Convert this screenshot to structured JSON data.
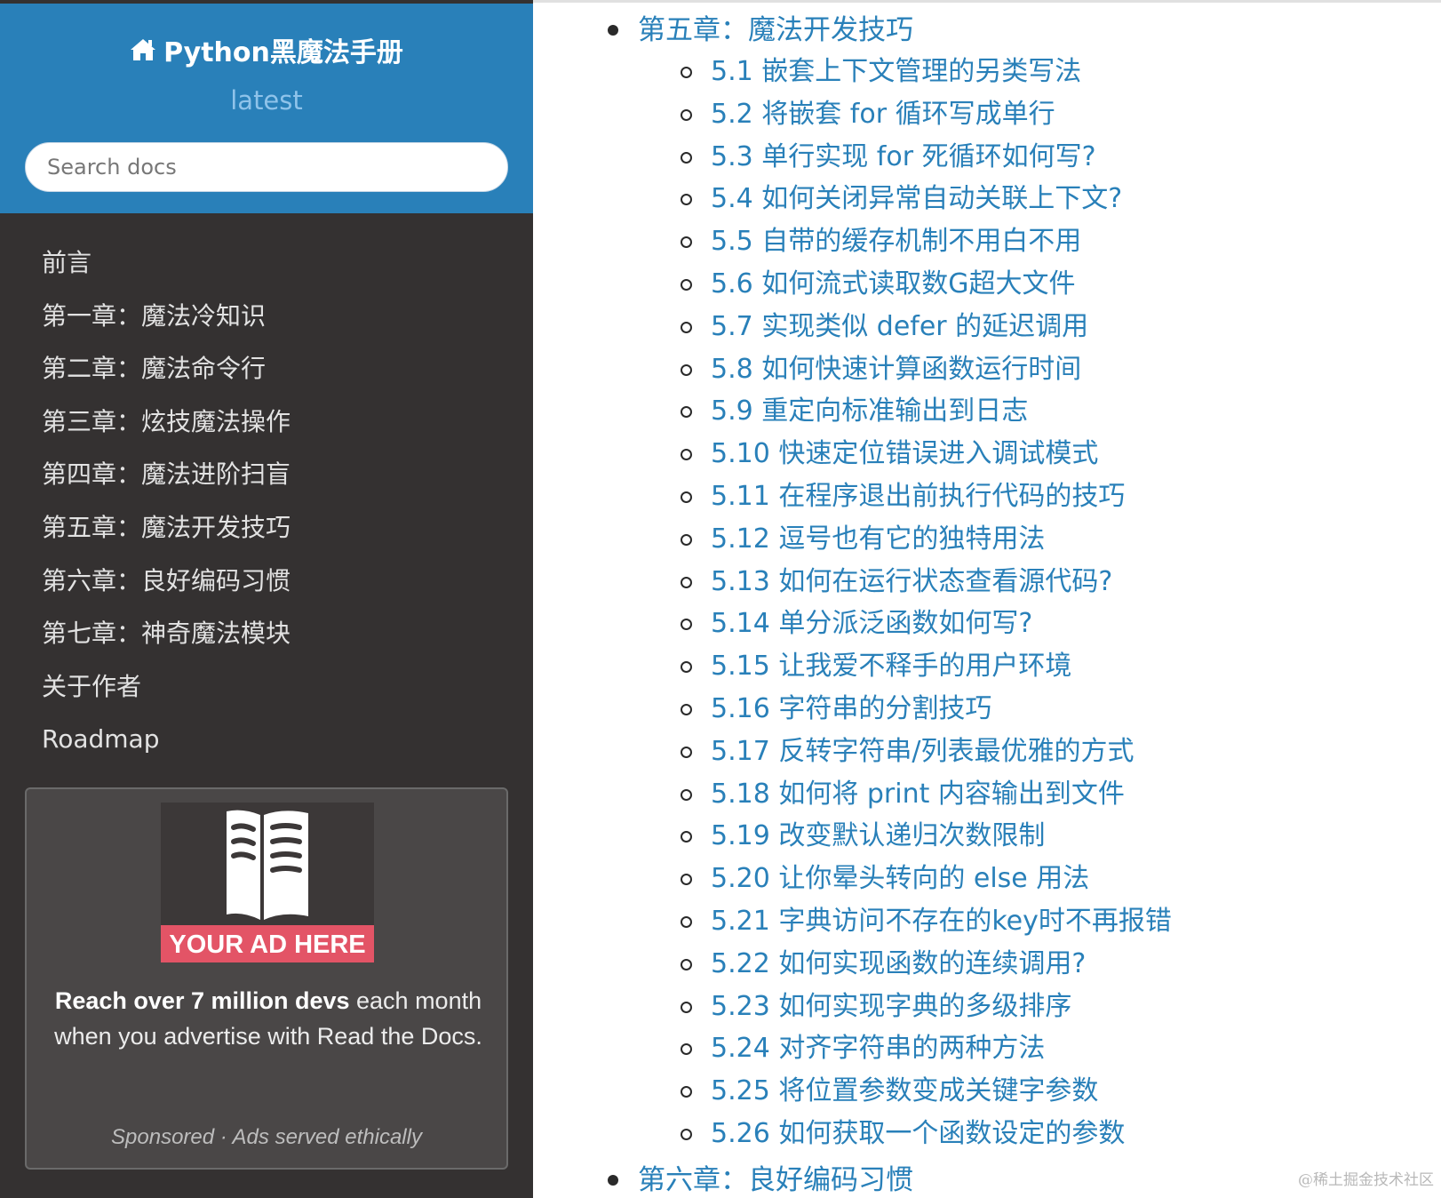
{
  "sidebar": {
    "title": "Python黑魔法手册",
    "home_icon": "home-icon",
    "version": "latest",
    "search_placeholder": "Search docs",
    "nav": [
      "前言",
      "第一章：魔法冷知识",
      "第二章：魔法命令行",
      "第三章：炫技魔法操作",
      "第四章：魔法进阶扫盲",
      "第五章：魔法开发技巧",
      "第六章：良好编码习惯",
      "第七章：神奇魔法模块",
      "关于作者",
      "Roadmap"
    ],
    "ad": {
      "banner": "YOUR AD HERE",
      "text_bold": "Reach over 7 million devs",
      "text_rest": " each month when you advertise with Read the Docs.",
      "sponsored": "Sponsored · Ads served ethically"
    }
  },
  "main": {
    "chapter_current": "第五章：魔法开发技巧",
    "chapter_next": "第六章：良好编码习惯",
    "sections": [
      "5.1 嵌套上下文管理的另类写法",
      "5.2 将嵌套 for 循环写成单行",
      "5.3 单行实现 for 死循环如何写?",
      "5.4 如何关闭异常自动关联上下文?",
      "5.5 自带的缓存机制不用白不用",
      "5.6 如何流式读取数G超大文件",
      "5.7 实现类似 defer 的延迟调用",
      "5.8 如何快速计算函数运行时间",
      "5.9 重定向标准输出到日志",
      "5.10 快速定位错误进入调试模式",
      "5.11 在程序退出前执行代码的技巧",
      "5.12 逗号也有它的独特用法",
      "5.13 如何在运行状态查看源代码?",
      "5.14 单分派泛函数如何写?",
      "5.15 让我爱不释手的用户环境",
      "5.16 字符串的分割技巧",
      "5.17 反转字符串/列表最优雅的方式",
      "5.18 如何将 print 内容输出到文件",
      "5.19 改变默认递归次数限制",
      "5.20 让你晕头转向的 else 用法",
      "5.21 字典访问不存在的key时不再报错",
      "5.22 如何实现函数的连续调用?",
      "5.23 如何实现字典的多级排序",
      "5.24 对齐字符串的两种方法",
      "5.25 将位置参数变成关键字参数",
      "5.26 如何获取一个函数设定的参数"
    ]
  },
  "watermark": "@稀土掘金技术社区",
  "colors": {
    "brand_blue": "#2980b9",
    "sidebar_bg": "#343131",
    "link": "#2980b9",
    "ad_banner": "#e35466"
  }
}
